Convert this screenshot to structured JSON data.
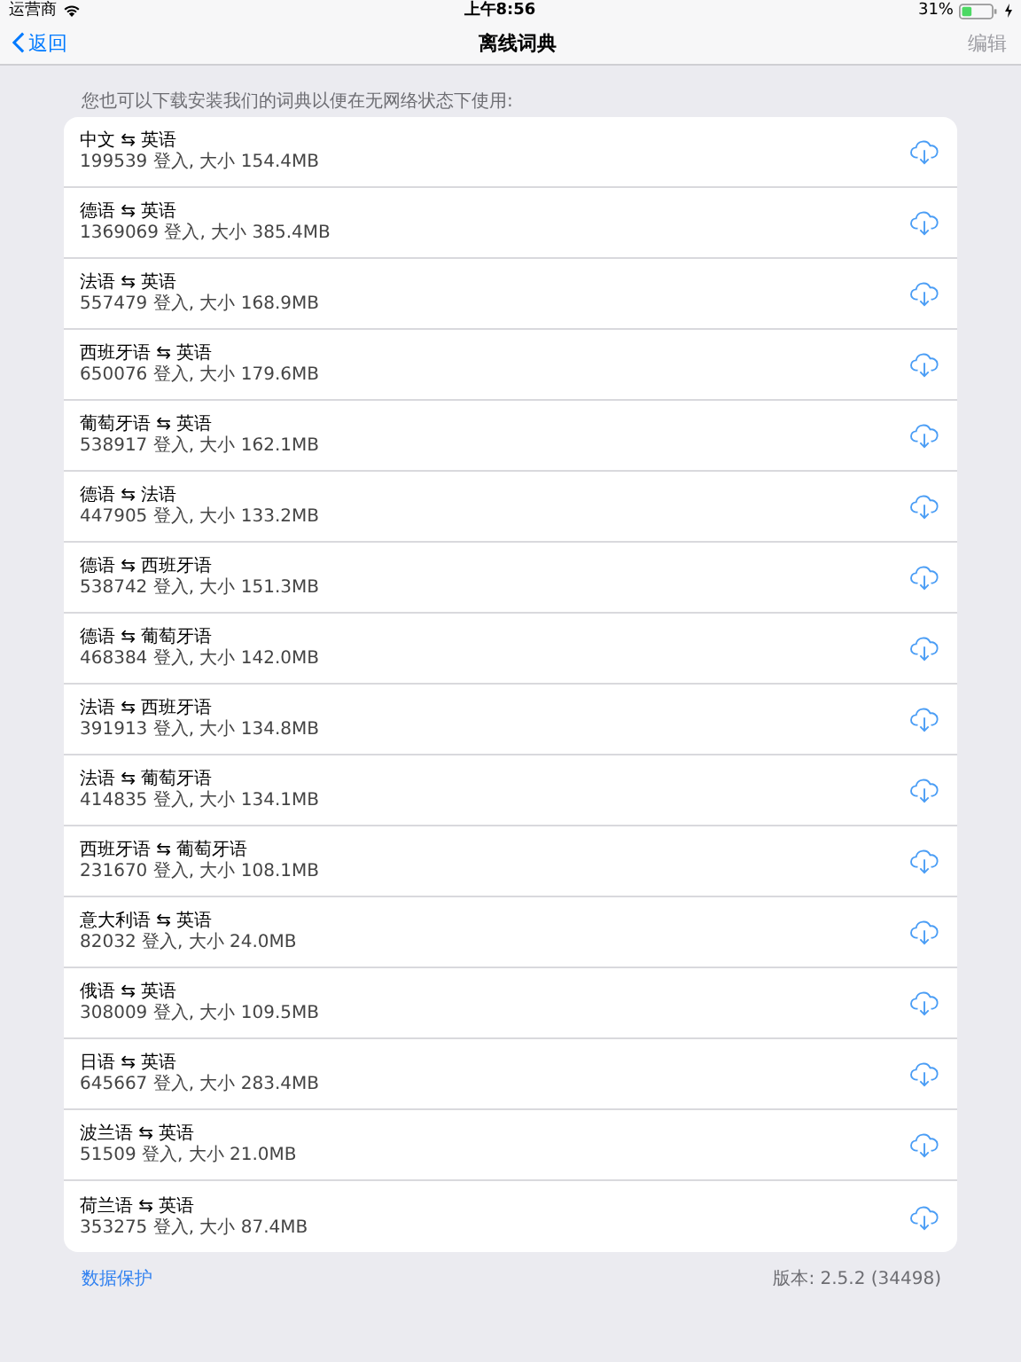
{
  "status_bar": {
    "carrier": "运营商",
    "time": "上午8:56",
    "battery": "31%"
  },
  "nav": {
    "back": "返回",
    "title": "离线词典",
    "edit": {
      "label": "编辑",
      "disabled": true
    }
  },
  "header": "您也可以下载安装我们的词典以便在无网络状态下使用:",
  "dictionaries": [
    {
      "title": "中文 ⇆ 英语",
      "detail": "199539 登入, 大小 154.4MB"
    },
    {
      "title": "德语 ⇆ 英语",
      "detail": "1369069 登入, 大小 385.4MB"
    },
    {
      "title": "法语 ⇆ 英语",
      "detail": "557479 登入, 大小 168.9MB"
    },
    {
      "title": "西班牙语 ⇆ 英语",
      "detail": "650076 登入, 大小 179.6MB"
    },
    {
      "title": "葡萄牙语 ⇆ 英语",
      "detail": "538917 登入, 大小 162.1MB"
    },
    {
      "title": "德语 ⇆ 法语",
      "detail": "447905 登入, 大小 133.2MB"
    },
    {
      "title": "德语 ⇆ 西班牙语",
      "detail": "538742 登入, 大小 151.3MB"
    },
    {
      "title": "德语 ⇆ 葡萄牙语",
      "detail": "468384 登入, 大小 142.0MB"
    },
    {
      "title": "法语 ⇆ 西班牙语",
      "detail": "391913 登入, 大小 134.8MB"
    },
    {
      "title": "法语 ⇆ 葡萄牙语",
      "detail": "414835 登入, 大小 134.1MB"
    },
    {
      "title": "西班牙语 ⇆ 葡萄牙语",
      "detail": "231670 登入, 大小 108.1MB"
    },
    {
      "title": "意大利语 ⇆ 英语",
      "detail": "82032 登入, 大小 24.0MB"
    },
    {
      "title": "俄语 ⇆ 英语",
      "detail": "308009 登入, 大小 109.5MB"
    },
    {
      "title": "日语 ⇆ 英语",
      "detail": "645667 登入, 大小 283.4MB"
    },
    {
      "title": "波兰语 ⇆ 英语",
      "detail": "51509 登入, 大小 21.0MB"
    },
    {
      "title": "荷兰语 ⇆ 英语",
      "detail": "353275 登入, 大小 87.4MB"
    }
  ],
  "footer": {
    "link": "数据保护",
    "version": "版本: 2.5.2 (34498)"
  }
}
